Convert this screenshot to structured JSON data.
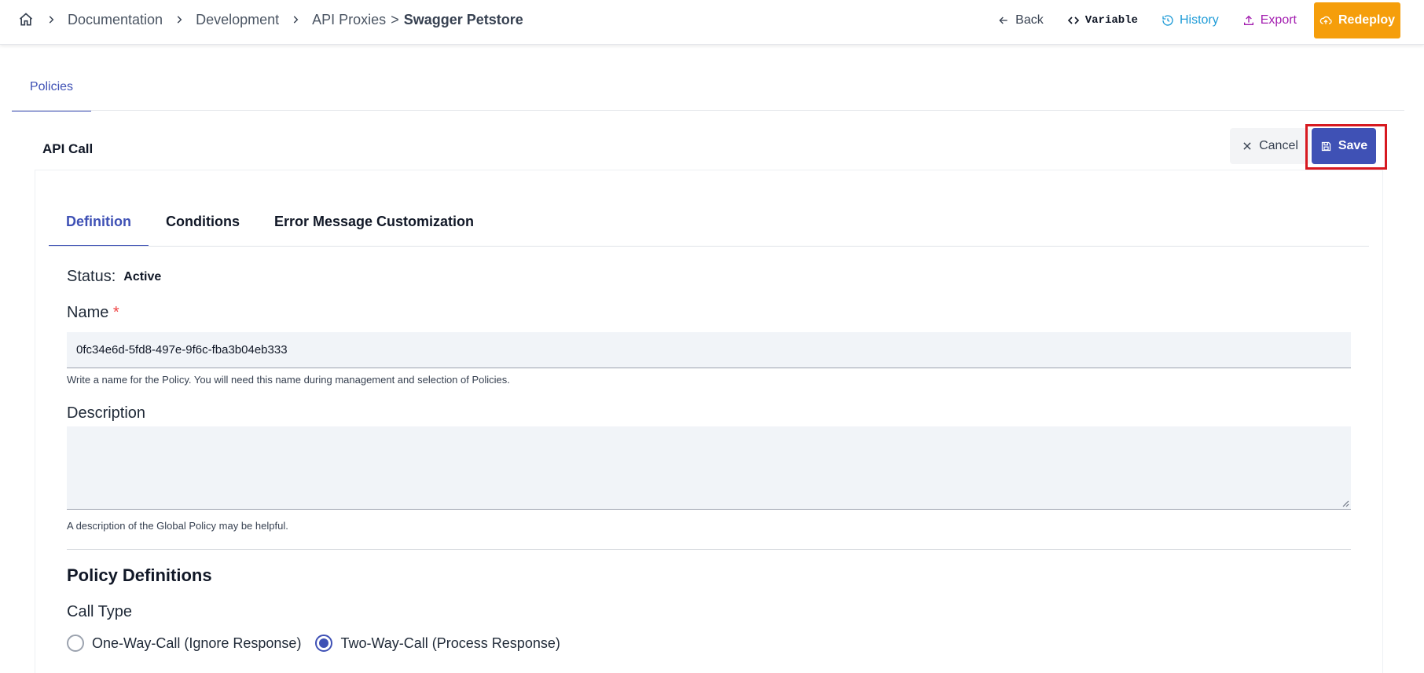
{
  "breadcrumb": {
    "items": [
      "Documentation",
      "Development",
      "API Proxies"
    ],
    "current": "Swagger Petstore"
  },
  "header_actions": {
    "back": "Back",
    "variable": "Variable",
    "history": "History",
    "export": "Export",
    "redeploy": "Redeploy"
  },
  "tabs": {
    "policies": "Policies"
  },
  "policy": {
    "title": "API Call",
    "cancel": "Cancel",
    "save": "Save",
    "subtabs": [
      "Definition",
      "Conditions",
      "Error Message Customization"
    ],
    "status_label": "Status:",
    "status_value": "Active",
    "name_label": "Name",
    "name_required": "*",
    "name_value": "0fc34e6d-5fd8-497e-9f6c-fba3b04eb333",
    "name_hint": "Write a name for the Policy. You will need this name during management and selection of Policies.",
    "description_label": "Description",
    "description_value": "",
    "description_hint": "A description of the Global Policy may be helpful.",
    "definitions_title": "Policy Definitions",
    "call_type_label": "Call Type",
    "call_types": [
      "One-Way-Call (Ignore Response)",
      "Two-Way-Call (Process Response)"
    ],
    "call_type_selected": "Two-Way-Call (Process Response)"
  },
  "colors": {
    "primary": "#3f51b5",
    "redeploy": "#f59e0b",
    "history": "#1e9bd7",
    "export": "#a21caf",
    "highlight": "#d71920"
  }
}
